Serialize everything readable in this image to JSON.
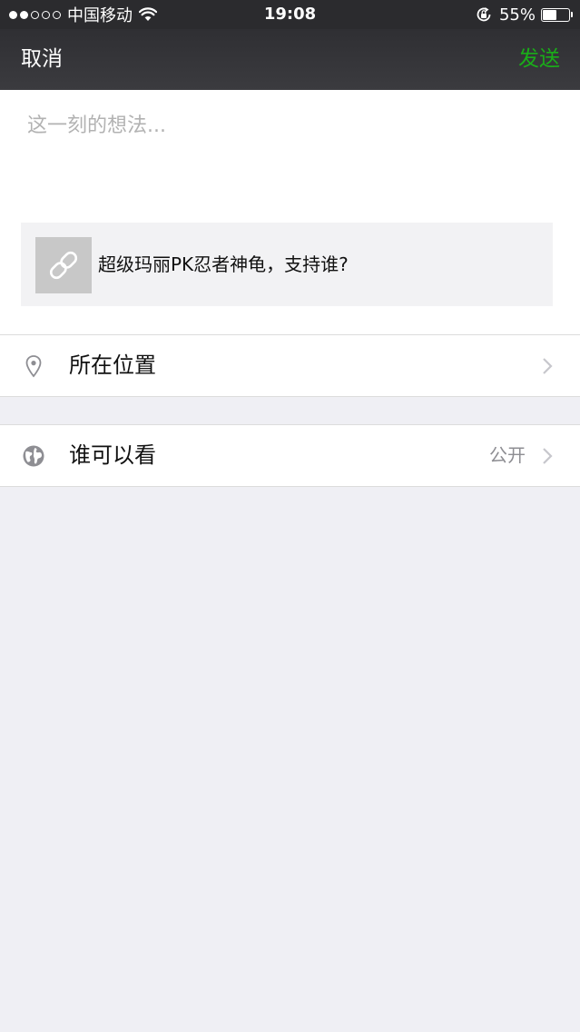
{
  "status_bar": {
    "signal_dots_filled": 2,
    "signal_dots_total": 5,
    "carrier": "中国移动",
    "wifi_icon": "wifi-icon",
    "time": "19:08",
    "rotation_lock_icon": "rotation-lock-icon",
    "battery_percent": "55%",
    "battery_level": 0.55
  },
  "nav": {
    "cancel_label": "取消",
    "send_label": "发送",
    "send_color": "#1aad19"
  },
  "compose": {
    "placeholder": "这一刻的想法...",
    "value": ""
  },
  "link_card": {
    "icon": "link-icon",
    "title": "超级玛丽PK忍者神龟，支持谁?"
  },
  "options": {
    "location": {
      "icon": "location-pin-icon",
      "label": "所在位置"
    },
    "visibility": {
      "icon": "globe-icon",
      "label": "谁可以看",
      "value": "公开"
    }
  },
  "colors": {
    "background": "#efeff4",
    "nav_background": "#333336",
    "accent": "#1aad19"
  }
}
